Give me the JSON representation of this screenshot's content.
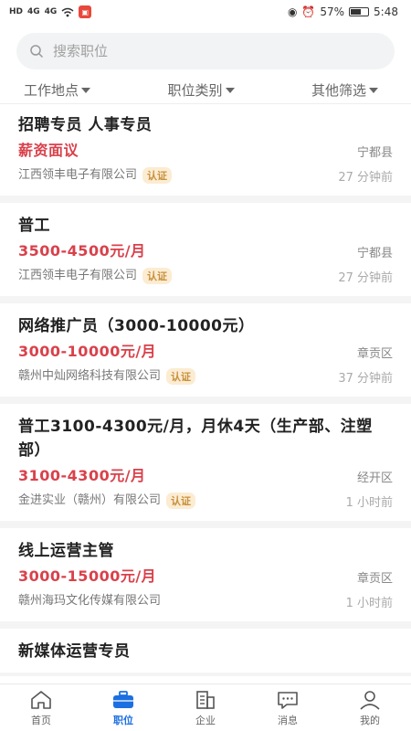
{
  "status_bar": {
    "left_chips": [
      "HD",
      "4G",
      "4G"
    ],
    "battery": "57%",
    "time": "5:48"
  },
  "search": {
    "placeholder": "搜索职位"
  },
  "filters": [
    {
      "label": "工作地点"
    },
    {
      "label": "职位类别"
    },
    {
      "label": "其他筛选"
    }
  ],
  "jobs": [
    {
      "title": "招聘专员 人事专员",
      "salary": "薪资面议",
      "location": "宁都县",
      "company": "江西领丰电子有限公司",
      "badge": "认证",
      "time": "27 分钟前"
    },
    {
      "title": "普工",
      "salary": "3500-4500元/月",
      "location": "宁都县",
      "company": "江西领丰电子有限公司",
      "badge": "认证",
      "time": "27 分钟前"
    },
    {
      "title": "网络推广员（3000-10000元）",
      "salary": "3000-10000元/月",
      "location": "章贡区",
      "company": "赣州中灿网络科技有限公司",
      "badge": "认证",
      "time": "37 分钟前"
    },
    {
      "title": "普工3100-4300元/月，月休4天（生产部、注塑部）",
      "salary": "3100-4300元/月",
      "location": "经开区",
      "company": "金进实业（赣州）有限公司",
      "badge": "认证",
      "time": "1 小时前"
    },
    {
      "title": "线上运营主管",
      "salary": "3000-15000元/月",
      "location": "章贡区",
      "company": "赣州海玛文化传媒有限公司",
      "badge": "",
      "time": "1 小时前"
    },
    {
      "title": "新媒体运营专员",
      "salary": "",
      "location": "",
      "company": "",
      "badge": "",
      "time": ""
    }
  ],
  "tabbar": [
    {
      "label": "首页",
      "icon": "home-icon"
    },
    {
      "label": "职位",
      "icon": "briefcase-icon"
    },
    {
      "label": "企业",
      "icon": "building-icon"
    },
    {
      "label": "消息",
      "icon": "message-icon"
    },
    {
      "label": "我的",
      "icon": "user-icon"
    }
  ],
  "colors": {
    "accent": "#1c6fe0",
    "salary": "#d9414b",
    "badge_bg": "#fbecd2",
    "badge_text": "#c8913e"
  }
}
